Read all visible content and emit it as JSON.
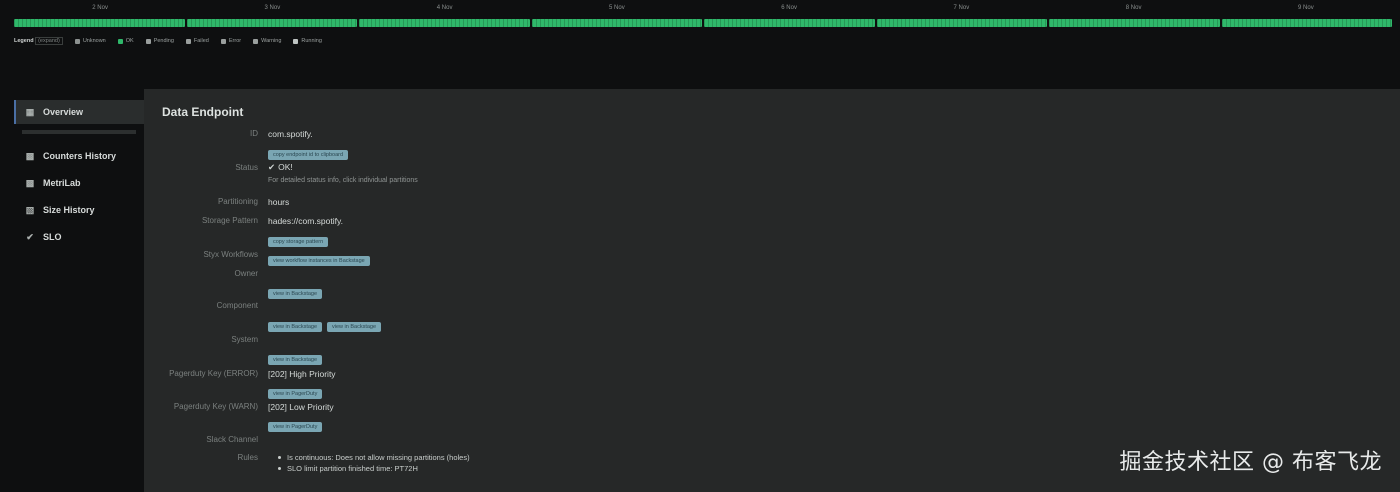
{
  "timeline": {
    "days": [
      "2 Nov",
      "3 Nov",
      "4 Nov",
      "5 Nov",
      "6 Nov",
      "7 Nov",
      "8 Nov",
      "9 Nov"
    ],
    "bar_color": "#2fb86a"
  },
  "legend": {
    "title": "Legend",
    "expand": "(expand)",
    "items": [
      {
        "label": "Unknown",
        "color": "#8c9190"
      },
      {
        "label": "OK",
        "color": "#2fb86a"
      },
      {
        "label": "Pending",
        "color": "#9a9f9e"
      },
      {
        "label": "Failed",
        "color": "#9a9f9e"
      },
      {
        "label": "Error",
        "color": "#9a9f9e"
      },
      {
        "label": "Warning",
        "color": "#9a9f9e"
      },
      {
        "label": "Running",
        "color": "#bfc4c3"
      }
    ]
  },
  "sidebar": {
    "items": [
      {
        "label": "Overview",
        "icon": "grid-icon"
      },
      {
        "label": "Counters History",
        "icon": "bar-chart-icon"
      },
      {
        "label": "MetriLab",
        "icon": "bar-chart-icon"
      },
      {
        "label": "Size History",
        "icon": "size-icon"
      },
      {
        "label": "SLO",
        "icon": "check-icon"
      }
    ]
  },
  "main": {
    "title": "Data Endpoint",
    "id": {
      "label": "ID",
      "value": "com.spotify.",
      "chip": "copy endpoint id to clipboard"
    },
    "status": {
      "label": "Status",
      "value": "OK!",
      "note": "For detailed status info, click individual partitions"
    },
    "partitioning": {
      "label": "Partitioning",
      "value": "hours"
    },
    "storage": {
      "label": "Storage Pattern",
      "value": "hades://com.spotify.",
      "chip": "copy storage pattern"
    },
    "styx": {
      "label": "Styx Workflows",
      "chip": "view workflow instances in Backstage"
    },
    "owner": {
      "label": "Owner",
      "chip": "view in Backstage"
    },
    "component": {
      "label": "Component",
      "chips": [
        "view in Backstage",
        "view in Backstage"
      ]
    },
    "system": {
      "label": "System",
      "chip": "view in Backstage"
    },
    "pd_error": {
      "label": "Pagerduty Key (ERROR)",
      "value": "[202] High Priority",
      "chip": "view in PagerDuty"
    },
    "pd_warn": {
      "label": "Pagerduty Key (WARN)",
      "value": "[202] Low Priority",
      "chip": "view in PagerDuty"
    },
    "slack": {
      "label": "Slack Channel"
    },
    "rules": {
      "label": "Rules",
      "items": [
        "Is continuous: Does not allow missing partitions (holes)",
        "SLO limit partition finished time: PT72H"
      ]
    }
  },
  "watermark": "掘金技术社区 @ 布客飞龙"
}
